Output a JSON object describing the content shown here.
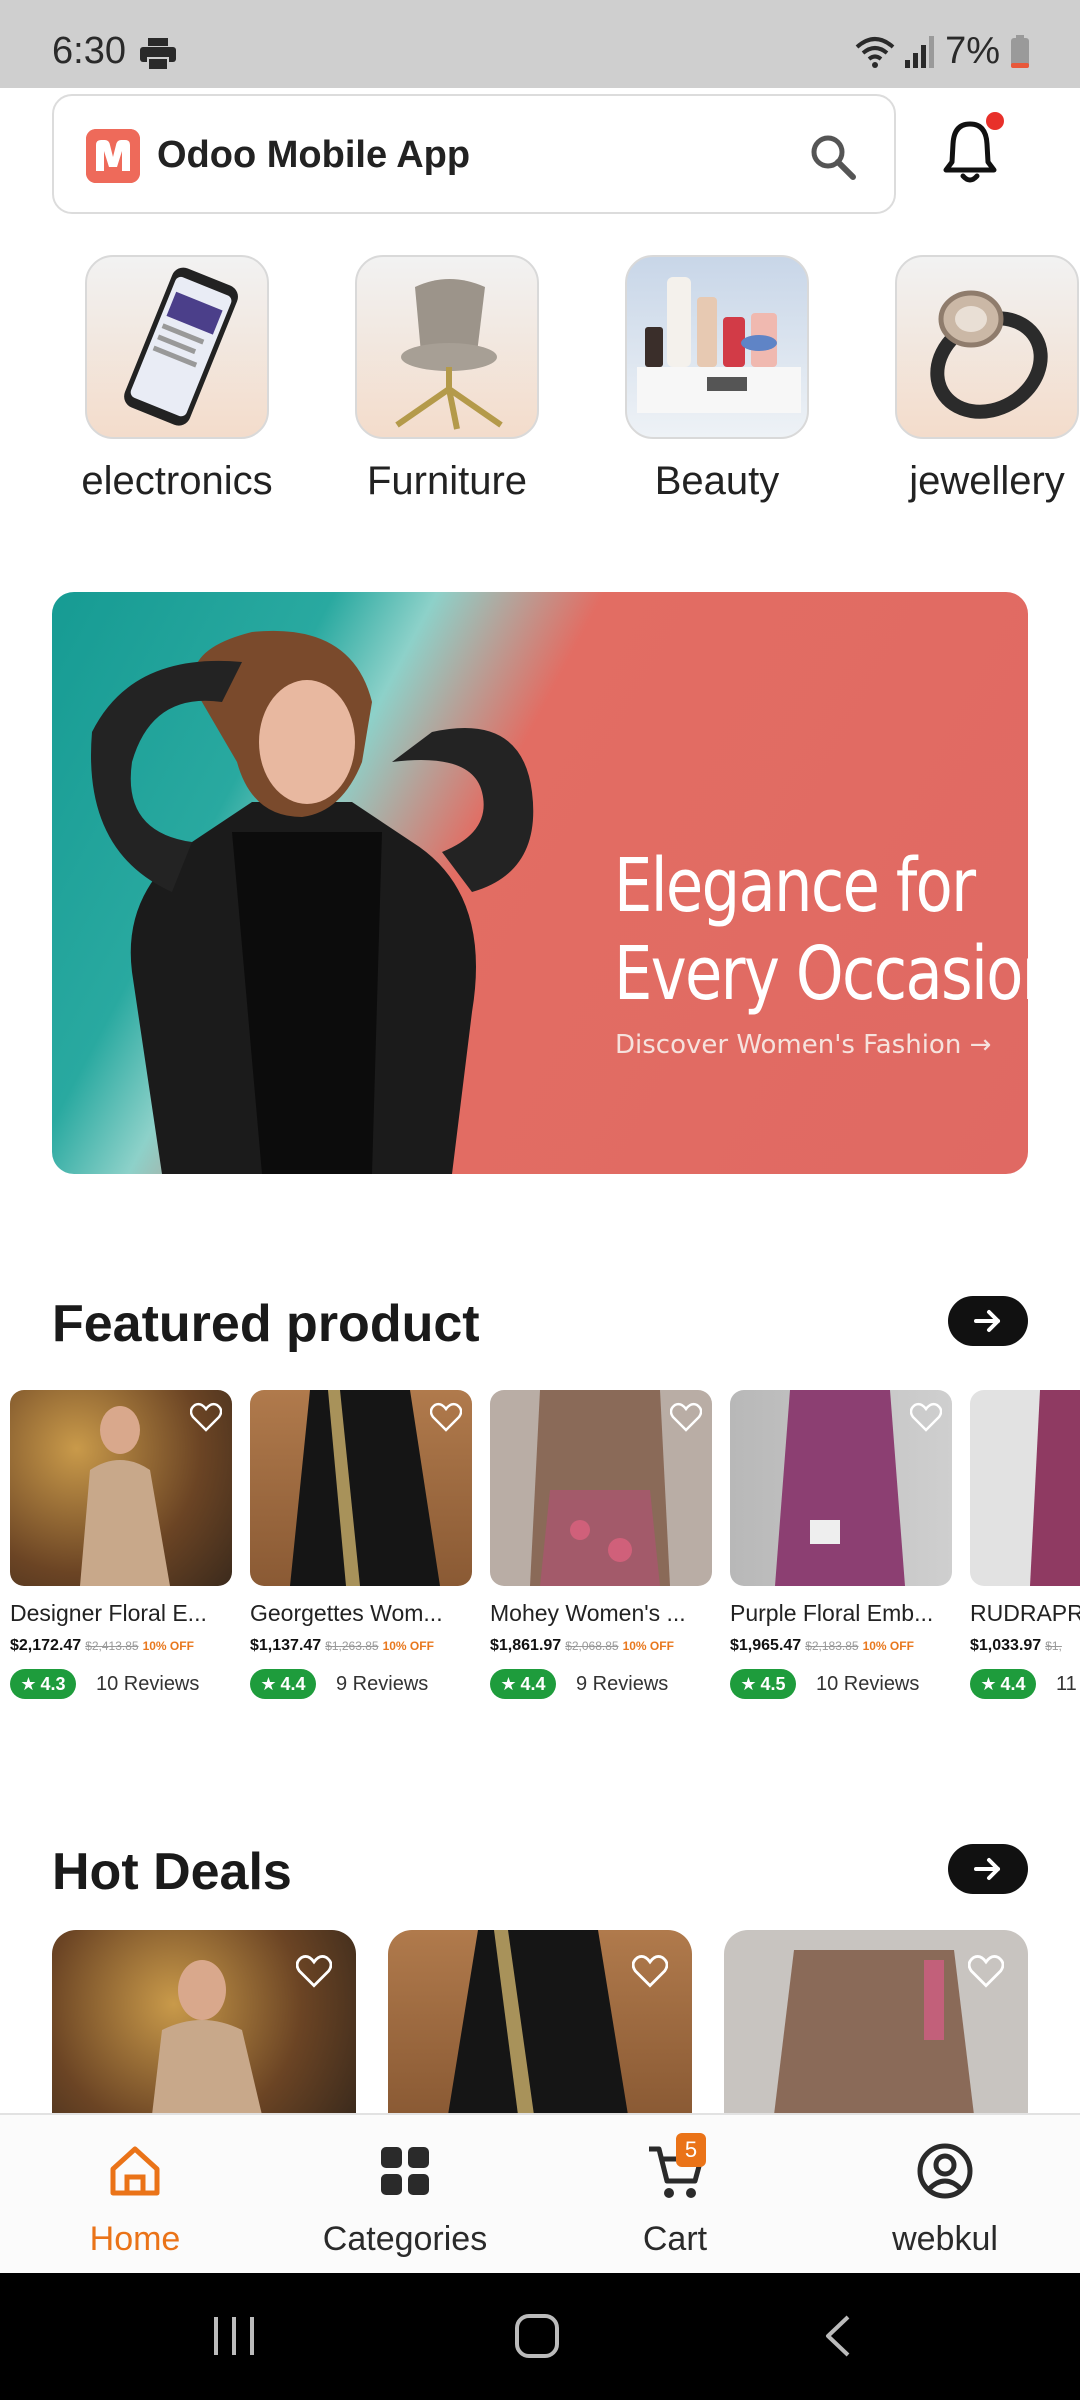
{
  "status_bar": {
    "time": "6:30",
    "battery": "7%"
  },
  "header": {
    "app_title": "Odoo Mobile App",
    "notification_dot_color": "#e8302a"
  },
  "categories": [
    {
      "label": "electronics"
    },
    {
      "label": "Furniture"
    },
    {
      "label": "Beauty"
    },
    {
      "label": "jewellery"
    }
  ],
  "banner": {
    "headline_line1": "Elegance for",
    "headline_line2": "Every Occasion",
    "subtitle": "Discover Women's Fashion →"
  },
  "featured": {
    "title": "Featured product",
    "products": [
      {
        "name": "Designer Floral E...",
        "price": "$2,172.47",
        "old_price": "$2,413.85",
        "discount": "10% OFF",
        "rating": "4.3",
        "reviews": "10 Reviews"
      },
      {
        "name": "Georgettes Wom...",
        "price": "$1,137.47",
        "old_price": "$1,263.85",
        "discount": "10% OFF",
        "rating": "4.4",
        "reviews": "9 Reviews"
      },
      {
        "name": "Mohey Women's ...",
        "price": "$1,861.97",
        "old_price": "$2,068.85",
        "discount": "10% OFF",
        "rating": "4.4",
        "reviews": "9 Reviews"
      },
      {
        "name": "Purple Floral Emb...",
        "price": "$1,965.47",
        "old_price": "$2,183.85",
        "discount": "10% OFF",
        "rating": "4.5",
        "reviews": "10 Reviews"
      },
      {
        "name": "RUDRAPR",
        "price": "$1,033.97",
        "old_price": "$1,",
        "discount": "",
        "rating": "4.4",
        "reviews": "11"
      }
    ]
  },
  "hot_deals": {
    "title": "Hot Deals"
  },
  "bottom_nav": {
    "items": [
      {
        "label": "Home",
        "active": true
      },
      {
        "label": "Categories",
        "active": false
      },
      {
        "label": "Cart",
        "active": false
      },
      {
        "label": "webkul",
        "active": false
      }
    ],
    "cart_count": "5",
    "accent_color": "#ea7318"
  }
}
